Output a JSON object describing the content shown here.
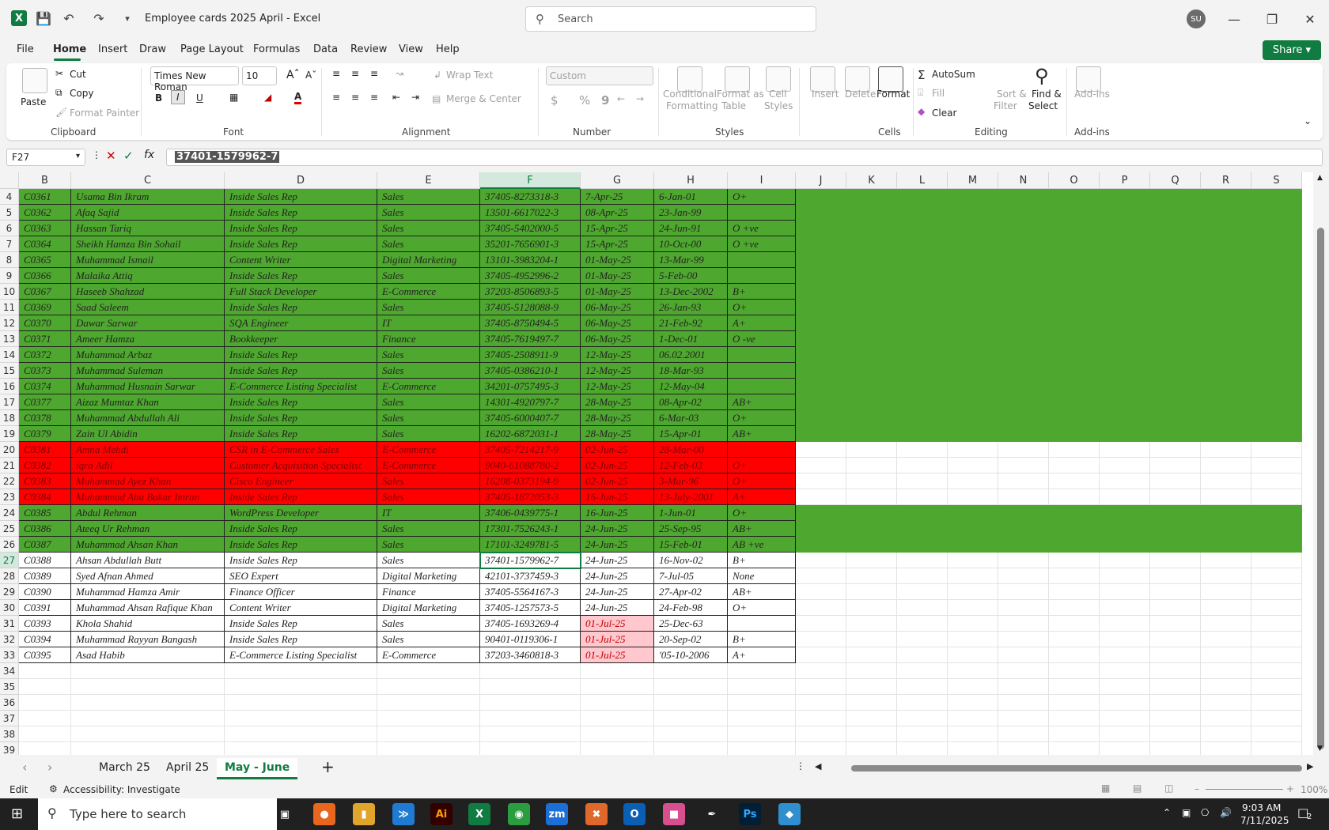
{
  "titlebar": {
    "app_icon": "X",
    "title": "Employee cards 2025 April  -  Excel",
    "search_placeholder": "Search",
    "avatar_initials": "SU"
  },
  "menu": [
    "File",
    "Home",
    "Insert",
    "Draw",
    "Page Layout",
    "Formulas",
    "Data",
    "Review",
    "View",
    "Help"
  ],
  "share_label": "Share",
  "ribbon": {
    "clipboard": {
      "paste": "Paste",
      "cut": "Cut",
      "copy": "Copy",
      "format_painter": "Format Painter",
      "group": "Clipboard"
    },
    "font": {
      "font_name": "Times New Roman",
      "font_size": "10",
      "group": "Font",
      "bold": "B",
      "italic": "I",
      "underline": "U"
    },
    "alignment": {
      "wrap_text": "Wrap Text",
      "merge": "Merge & Center",
      "group": "Alignment"
    },
    "number": {
      "format": "Custom",
      "group": "Number",
      "currency": "$",
      "percent": "%",
      "comma": "9"
    },
    "styles": {
      "conditional": "Conditional",
      "conditional2": "Formatting",
      "format_table": "Format as",
      "format_table2": "Table",
      "cell_styles": "Cell",
      "cell_styles2": "Styles",
      "group": "Styles"
    },
    "cells": {
      "insert": "Insert",
      "delete": "Delete",
      "format": "Format",
      "group": "Cells"
    },
    "editing": {
      "autosum": "AutoSum",
      "fill": "Fill",
      "clear": "Clear",
      "sort": "Sort &",
      "sort2": "Filter",
      "find": "Find &",
      "find2": "Select",
      "group": "Editing"
    },
    "addins": {
      "label": "Add-ins",
      "group": "Add-ins"
    }
  },
  "formula_bar": {
    "name_box": "F27",
    "fx": "fx",
    "value": "37401-1579962-7"
  },
  "columns": [
    "B",
    "C",
    "D",
    "E",
    "F",
    "G",
    "H",
    "I",
    "J",
    "K",
    "L",
    "M",
    "N",
    "O",
    "P",
    "Q",
    "R",
    "S"
  ],
  "rows": [
    {
      "n": "4",
      "fill": "green",
      "cells": [
        "C0361",
        "Usama Bin Ikram",
        "Inside Sales Rep",
        "Sales",
        "37405-8273318-3",
        "7-Apr-25",
        "6-Jan-01",
        "O+"
      ]
    },
    {
      "n": "5",
      "fill": "green",
      "cells": [
        "C0362",
        "Afaq Sajid",
        "Inside Sales Rep",
        "Sales",
        "13501-6617022-3",
        "08-Apr-25",
        "23-Jan-99",
        ""
      ]
    },
    {
      "n": "6",
      "fill": "green",
      "cells": [
        "C0363",
        "Hassan Tariq",
        "Inside Sales Rep",
        "Sales",
        "37405-5402000-5",
        "15-Apr-25",
        "24-Jun-91",
        "O +ve"
      ]
    },
    {
      "n": "7",
      "fill": "green",
      "cells": [
        "C0364",
        "Sheikh Hamza Bin Sohail",
        "Inside Sales Rep",
        "Sales",
        "35201-7656901-3",
        "15-Apr-25",
        "10-Oct-00",
        "O +ve"
      ]
    },
    {
      "n": "8",
      "fill": "green",
      "cells": [
        "C0365",
        "Muhammad Ismail",
        "Content Writer",
        "Digital Marketing",
        "13101-3983204-1",
        "01-May-25",
        "13-Mar-99",
        ""
      ]
    },
    {
      "n": "9",
      "fill": "green",
      "cells": [
        "C0366",
        "Malaika Attiq",
        "Inside Sales Rep",
        "Sales",
        "37405-4952996-2",
        "01-May-25",
        "5-Feb-00",
        ""
      ]
    },
    {
      "n": "10",
      "fill": "green",
      "cells": [
        "C0367",
        "Haseeb Shahzad",
        "Full Stack Developer",
        "E-Commerce",
        "37203-8506893-5",
        "01-May-25",
        "13-Dec-2002",
        "B+"
      ]
    },
    {
      "n": "11",
      "fill": "green",
      "cells": [
        "C0369",
        "Saad Saleem",
        "Inside Sales Rep",
        "Sales",
        "37405-5128088-9",
        "06-May-25",
        "26-Jan-93",
        "O+"
      ]
    },
    {
      "n": "12",
      "fill": "green",
      "cells": [
        "C0370",
        "Dawar Sarwar",
        "SQA Engineer",
        "IT",
        "37405-8750494-5",
        "06-May-25",
        "21-Feb-92",
        "A+"
      ]
    },
    {
      "n": "13",
      "fill": "green",
      "cells": [
        "C0371",
        "Ameer Hamza",
        "Bookkeeper",
        "Finance",
        "37405-7619497-7",
        "06-May-25",
        "1-Dec-01",
        "O -ve"
      ]
    },
    {
      "n": "14",
      "fill": "green",
      "cells": [
        "C0372",
        "Muhammad Arbaz",
        "Inside Sales Rep",
        "Sales",
        "37405-2508911-9",
        "12-May-25",
        "06.02.2001",
        ""
      ]
    },
    {
      "n": "15",
      "fill": "green",
      "cells": [
        "C0373",
        "Muhammad Suleman",
        "Inside Sales Rep",
        "Sales",
        "37405-0386210-1",
        "12-May-25",
        "18-Mar-93",
        ""
      ]
    },
    {
      "n": "16",
      "fill": "green",
      "cells": [
        "C0374",
        "Muhammad Husnain Sarwar",
        "E-Commerce Listing Specialist",
        "E-Commerce",
        "34201-0757495-3",
        "12-May-25",
        "12-May-04",
        ""
      ]
    },
    {
      "n": "17",
      "fill": "green",
      "cells": [
        "C0377",
        "Aizaz Mumtaz Khan",
        "Inside Sales Rep",
        "Sales",
        "14301-4920797-7",
        "28-May-25",
        "08-Apr-02",
        "AB+"
      ]
    },
    {
      "n": "18",
      "fill": "green",
      "cells": [
        "C0378",
        "Muhammad Abdullah Ali",
        "Inside Sales Rep",
        "Sales",
        "37405-6000407-7",
        "28-May-25",
        "6-Mar-03",
        "O+"
      ]
    },
    {
      "n": "19",
      "fill": "green",
      "cells": [
        "C0379",
        "Zain Ul Abidin",
        "Inside Sales Rep",
        "Sales",
        "16202-6872031-1",
        "28-May-25",
        "15-Apr-01",
        "AB+"
      ]
    },
    {
      "n": "20",
      "fill": "red",
      "cells": [
        "C0381",
        "Amna Mehdi",
        "CSR in E-Commerce Sales",
        "E-Commerce",
        "37405-7214217-9",
        "02-Jun-25",
        "28-Mar-00",
        ""
      ]
    },
    {
      "n": "21",
      "fill": "red",
      "cells": [
        "C0382",
        "iqra Adil",
        "Customer Acquisition Specialist",
        "E-Commerce",
        "9040-61088780-2",
        "02-Jun-25",
        "12-Feb-03",
        "O+"
      ]
    },
    {
      "n": "22",
      "fill": "red",
      "cells": [
        "C0383",
        "Muhammad Ayez Khan",
        "Cisco Engineer",
        "Sales",
        "16208-0373194-9",
        "02-Jun-25",
        "3-Mar-96",
        "O+"
      ]
    },
    {
      "n": "23",
      "fill": "red",
      "cells": [
        "C0384",
        "Muhammad Abu Bakar Imran",
        "Inside Sales Rep",
        "Sales",
        "37405-1872053-3",
        "16-Jun-25",
        "13-July-2001",
        "A+"
      ]
    },
    {
      "n": "24",
      "fill": "green",
      "cells": [
        "C0385",
        "Abdul Rehman",
        "WordPress Developer",
        "IT",
        "37406-0439775-1",
        "16-Jun-25",
        "1-Jun-01",
        "O+"
      ]
    },
    {
      "n": "25",
      "fill": "green",
      "cells": [
        "C0386",
        "Ateeq Ur Rehman",
        "Inside Sales Rep",
        "Sales",
        "17301-7526243-1",
        "24-Jun-25",
        "25-Sep-95",
        "AB+"
      ]
    },
    {
      "n": "26",
      "fill": "green",
      "cells": [
        "C0387",
        "Muhammad Ahsan Khan",
        "Inside Sales Rep",
        "Sales",
        "17101-3249781-5",
        "24-Jun-25",
        "15-Feb-01",
        "AB +ve"
      ]
    },
    {
      "n": "27",
      "fill": "white",
      "cells": [
        "C0388",
        "Ahsan Abdullah Butt",
        "Inside Sales Rep",
        "Sales",
        "37401-1579962-7",
        "24-Jun-25",
        "16-Nov-02",
        "B+"
      ]
    },
    {
      "n": "28",
      "fill": "white",
      "cells": [
        "C0389",
        "Syed Afnan Ahmed",
        "SEO Expert",
        "Digital Marketing",
        "42101-3737459-3",
        "24-Jun-25",
        "7-Jul-05",
        "None"
      ]
    },
    {
      "n": "29",
      "fill": "white",
      "cells": [
        "C0390",
        "Muhammad Hamza Amir",
        "Finance Officer",
        "Finance",
        "37405-5564167-3",
        "24-Jun-25",
        "27-Apr-02",
        "AB+"
      ]
    },
    {
      "n": "30",
      "fill": "white",
      "cells": [
        "C0391",
        "Muhammad Ahsan Rafique Khan",
        "Content Writer",
        "Digital Marketing",
        "37405-1257573-5",
        "24-Jun-25",
        "24-Feb-98",
        "O+"
      ]
    },
    {
      "n": "31",
      "fill": "white",
      "pinkG": true,
      "cells": [
        "C0393",
        "Khola Shahid",
        "Inside Sales Rep",
        "Sales",
        "37405-1693269-4",
        "01-Jul-25",
        "25-Dec-63",
        ""
      ]
    },
    {
      "n": "32",
      "fill": "white",
      "pinkG": true,
      "cells": [
        "C0394",
        "Muhammad Rayyan Bangash",
        "Inside Sales Rep",
        "Sales",
        "90401-0119306-1",
        "01-Jul-25",
        "20-Sep-02",
        "B+"
      ]
    },
    {
      "n": "33",
      "fill": "white",
      "pinkG": true,
      "cells": [
        "C0395",
        "Asad Habib",
        "E-Commerce Listing Specialist",
        "E-Commerce",
        "37203-3460818-3",
        "01-Jul-25",
        "'05-10-2006",
        "A+"
      ]
    },
    {
      "n": "34",
      "fill": "empty",
      "cells": []
    },
    {
      "n": "35",
      "fill": "empty",
      "cells": []
    },
    {
      "n": "36",
      "fill": "empty",
      "cells": []
    },
    {
      "n": "37",
      "fill": "empty",
      "cells": []
    },
    {
      "n": "38",
      "fill": "empty",
      "cells": []
    },
    {
      "n": "39",
      "fill": "empty",
      "cells": []
    }
  ],
  "colors": {
    "green": "#4ea72e",
    "red": "#ff0000",
    "pink": "#ffc7ce",
    "accent": "#107c41"
  },
  "sheets": [
    "March 25",
    "April 25",
    "May - June"
  ],
  "active_sheet": "May - June",
  "status": {
    "mode": "Edit",
    "accessibility": "Accessibility: Investigate",
    "zoom": "100%"
  },
  "taskbar": {
    "search_placeholder": "Type here to search",
    "time": "9:03 AM",
    "date": "7/11/2025",
    "notifications": "2"
  }
}
